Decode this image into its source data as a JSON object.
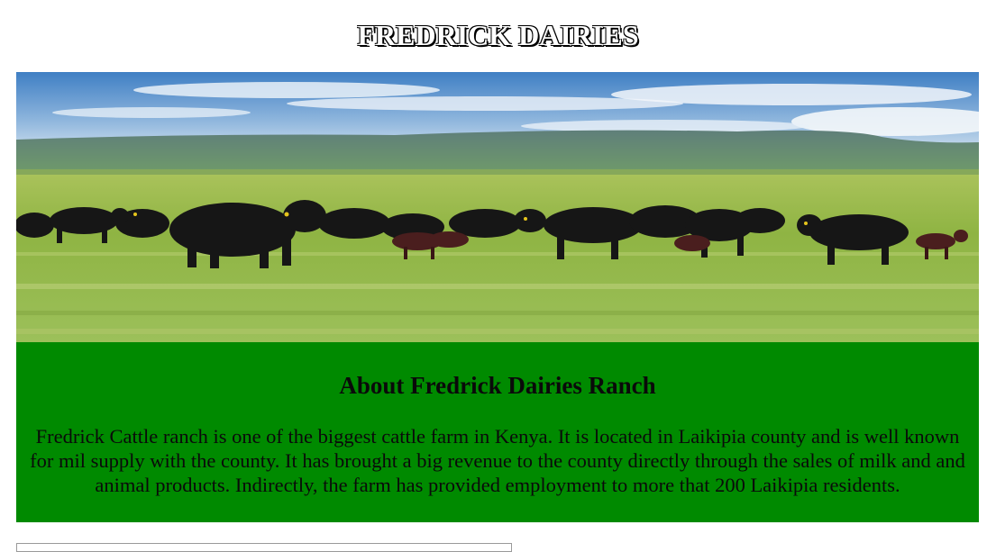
{
  "header": {
    "title": "FREDRICK DAIRIES"
  },
  "hero": {
    "image_subject": "herd of black cattle grazing on green grassland under blue sky"
  },
  "about": {
    "heading": "About Fredrick Dairies Ranch",
    "body": "Fredrick Cattle ranch is one of the biggest cattle farm in Kenya. It is located in Laikipia county and is well known for mil supply with the county. It has brought a big revenue to the county directly through the sales of milk and and animal products. Indirectly, the farm has provided employment to more that 200 Laikipia residents."
  },
  "colors": {
    "about_background": "#008a00",
    "title_text": "#ffffff",
    "title_shadow": "#000000"
  }
}
